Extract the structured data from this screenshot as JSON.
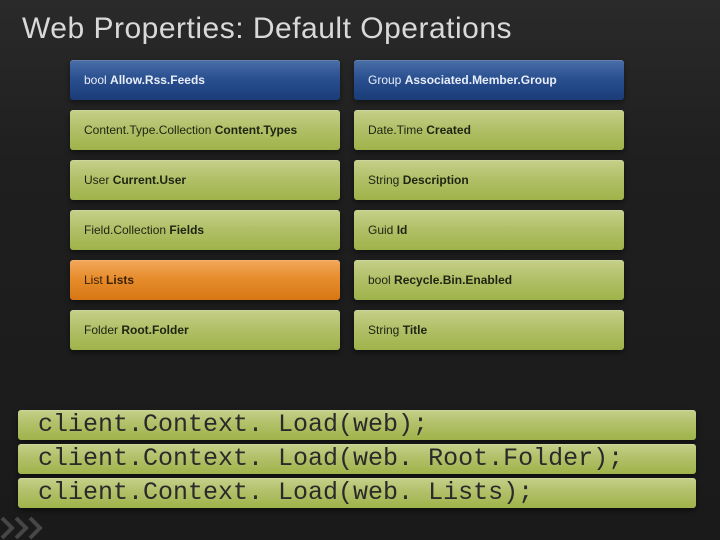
{
  "title": "Web Properties: Default Operations",
  "cells": {
    "r0c0": {
      "type": "bool",
      "name": "Allow.Rss.Feeds",
      "variant": "blue"
    },
    "r0c1": {
      "type": "Group",
      "name": "Associated.Member.Group",
      "variant": "blue"
    },
    "r1c0": {
      "type": "Content.Type.Collection",
      "name": "Content.Types",
      "variant": "green"
    },
    "r1c1": {
      "type": "Date.Time",
      "name": "Created",
      "variant": "green"
    },
    "r2c0": {
      "type": "User",
      "name": "Current.User",
      "variant": "green"
    },
    "r2c1": {
      "type": "String",
      "name": "Description",
      "variant": "green"
    },
    "r3c0": {
      "type": "Field.Collection",
      "name": "Fields",
      "variant": "green"
    },
    "r3c1": {
      "type": "Guid",
      "name": "Id",
      "variant": "green"
    },
    "r4c0": {
      "type": "List",
      "name": "Lists",
      "variant": "orange"
    },
    "r4c1": {
      "type": "bool",
      "name": "Recycle.Bin.Enabled",
      "variant": "green"
    },
    "r5c0": {
      "type": "Folder",
      "name": "Root.Folder",
      "variant": "green"
    },
    "r5c1": {
      "type": "String",
      "name": "Title",
      "variant": "green"
    }
  },
  "code": {
    "line1": "client.Context. Load(web);",
    "line2": "client.Context. Load(web. Root.Folder);",
    "line3": "client.Context. Load(web. Lists);"
  }
}
